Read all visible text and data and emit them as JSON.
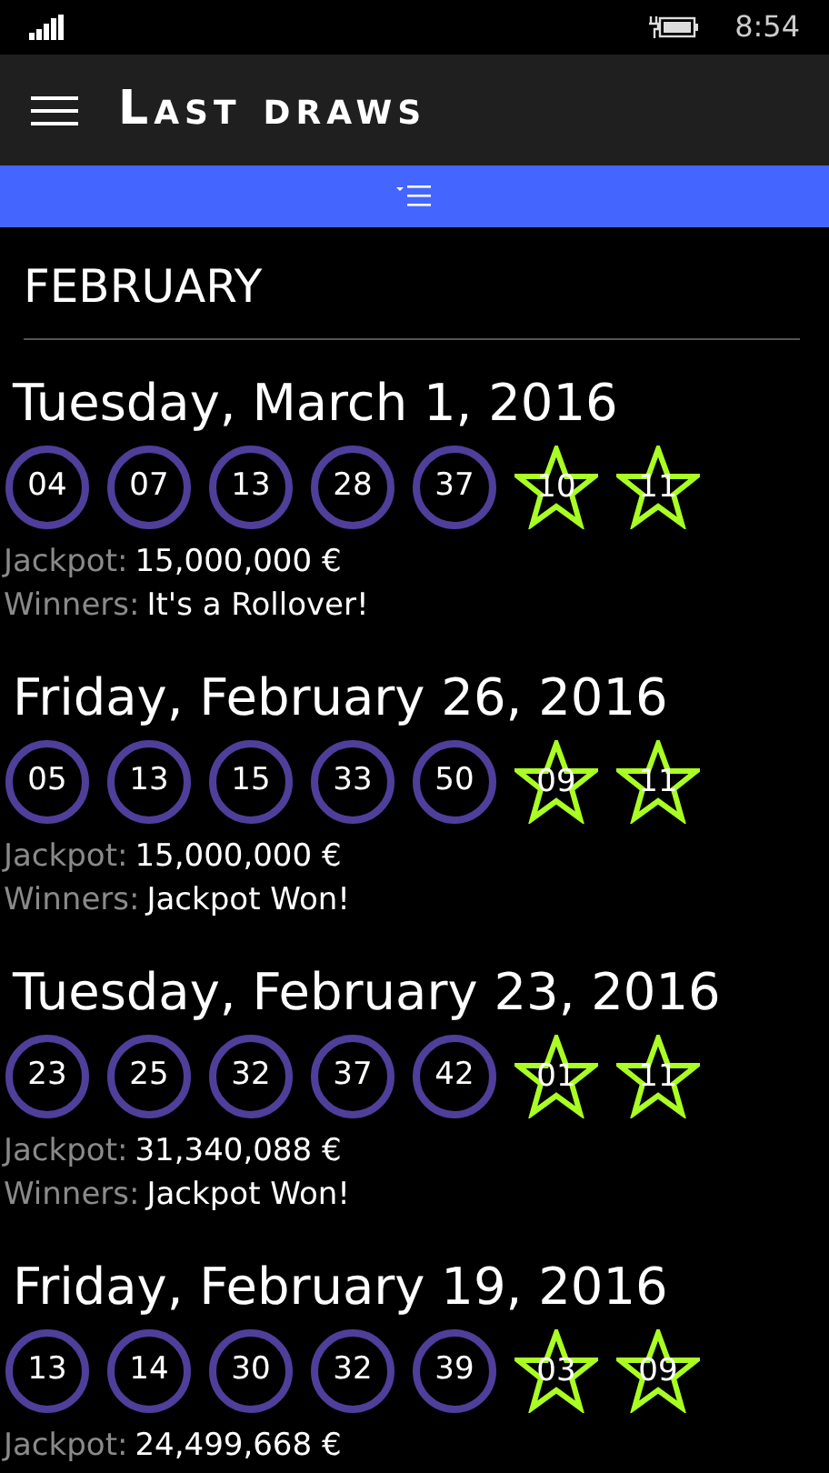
{
  "status_bar": {
    "time": "8:54"
  },
  "header": {
    "title": "Last draws"
  },
  "month": "FEBRUARY",
  "draws": [
    {
      "date": "Tuesday, March 1, 2016",
      "numbers": [
        "04",
        "07",
        "13",
        "28",
        "37"
      ],
      "stars": [
        "10",
        "11"
      ],
      "jackpot_label": "Jackpot:",
      "jackpot": "15,000,000 €",
      "winners_label": "Winners:",
      "winners": "It's a Rollover!"
    },
    {
      "date": "Friday, February 26, 2016",
      "numbers": [
        "05",
        "13",
        "15",
        "33",
        "50"
      ],
      "stars": [
        "09",
        "11"
      ],
      "jackpot_label": "Jackpot:",
      "jackpot": "15,000,000 €",
      "winners_label": "Winners:",
      "winners": "Jackpot Won!"
    },
    {
      "date": "Tuesday, February 23, 2016",
      "numbers": [
        "23",
        "25",
        "32",
        "37",
        "42"
      ],
      "stars": [
        "01",
        "11"
      ],
      "jackpot_label": "Jackpot:",
      "jackpot": "31,340,088 €",
      "winners_label": "Winners:",
      "winners": "Jackpot Won!"
    },
    {
      "date": "Friday, February 19, 2016",
      "numbers": [
        "13",
        "14",
        "30",
        "32",
        "39"
      ],
      "stars": [
        "03",
        "09"
      ],
      "jackpot_label": "Jackpot:",
      "jackpot": "24,499,668 €"
    }
  ]
}
